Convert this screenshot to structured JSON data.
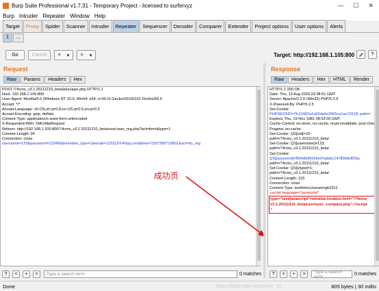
{
  "window": {
    "title": "Burp Suite Professional v1.7.31 - Temporary Project - licensed to surferxyz",
    "minimize": "—",
    "maximize": "☐",
    "close": "✕"
  },
  "menu": [
    "Burp",
    "Intruder",
    "Repeater",
    "Window",
    "Help"
  ],
  "tabs": [
    "Target",
    "Proxy",
    "Spider",
    "Scanner",
    "Intruder",
    "Repeater",
    "Sequencer",
    "Decoder",
    "Comparer",
    "Extender",
    "Project options",
    "User options",
    "Alerts"
  ],
  "subtabs": [
    "1",
    "..."
  ],
  "toolbar": {
    "go": "Go",
    "cancel": "Cancel",
    "back": "<",
    "forward": ">",
    "dropdown": "▾",
    "target_label": "Target: http://192.168.1.105:800",
    "edit_icon": "pencil-icon",
    "help": "?"
  },
  "request": {
    "heading": "Request",
    "tabs": [
      "Raw",
      "Params",
      "Headers",
      "Hex"
    ],
    "lines": [
      "POST /74cms_v3.1.20111210_beta/plus/ajax.php HTTP/1.1",
      "Host: 192.168.1.105:800",
      "User-Agent: Mozilla/5.0 (Windows NT 10.0; Win64; x64; rv:56.0) Gecko/20100101 Firefox/56.0",
      "Accept: */*",
      "Accept-Language: zh-CN,zh;q=0.8,en-US;q=0.5,en;q=0.3",
      "Accept-Encoding: gzip, deflate",
      "Content-Type: application/x-www-form-urlencoded",
      "X-Requested-With: XMLHttpRequest",
      "Referer: http://192.168.1.105:800/74cms_v3.1.20111210_beta/user/user_reg.php?act=form&type=1",
      "Content-Length: 94",
      "Connection: close",
      "",
      "username=123&password=123456&member_type=1&email=123312%40qq.com&time=1597289719801&act=do_reg"
    ],
    "search_placeholder": "Type a search term",
    "matches": "0 matches",
    "annotation": "成功页"
  },
  "response": {
    "heading": "Response",
    "tabs": [
      "Raw",
      "Headers",
      "Hex",
      "HTML",
      "Render"
    ],
    "lines": [
      "HTTP/1.1 200 OK",
      "Date: Thu, 13 Aug 2020 03:38:51 GMT",
      "Server: Apache/2.2.6 (Win32) PHP/5.2.5",
      "X-Powered-By: PHP/5.2.5",
      "Set-Cookie:",
      "PHPSESSID=7fc11482a1a65da0e2065ca1ac12618; path=/",
      "Expires: Thu, 19 Nov 1981 08:52:00 GMT",
      "Cache-Control: no-store, no-cache, must-revalidate, post-check=0, pre-check=0",
      "Pragma: no-cache",
      "Set-Cookie: QS[uid]=19;",
      "path=/74cms_v3.1.20111210_beta/",
      "Set-Cookie: QS[username]=123;",
      "path=/74cms_v3.1.20111210_beta/",
      "Set-Cookie:",
      "QS[password]=f604dbf6934ed7ada5c14780b8cff29a;",
      "path=/74cms_v3.1.20111210_beta/",
      "Set-Cookie: QS[utype]=1;",
      "path=/74cms_v3.1.20111210_beta/",
      "Content-Length: 133",
      "Connection: close",
      "Content-Type: text/html;charset=gb2312",
      "",
      "<script language=\"javascript\"",
      "type=\"text/javascript\">window.location.href=\"/74cms_",
      "v3.1.20111210_beta/user/user_company.php\";</script",
      ">"
    ],
    "search_placeholder": "Type a search term",
    "matches": "0 matches"
  },
  "status": {
    "left": "Done",
    "right": "805 bytes | 30 millis",
    "watermark": "https://blog.csdn.net/weixin_51..."
  },
  "colors": {
    "accent": "#e8711b",
    "highlight_box": "#e01010",
    "annotation_text": "#e01010",
    "link_blue": "#1f3fd0"
  }
}
